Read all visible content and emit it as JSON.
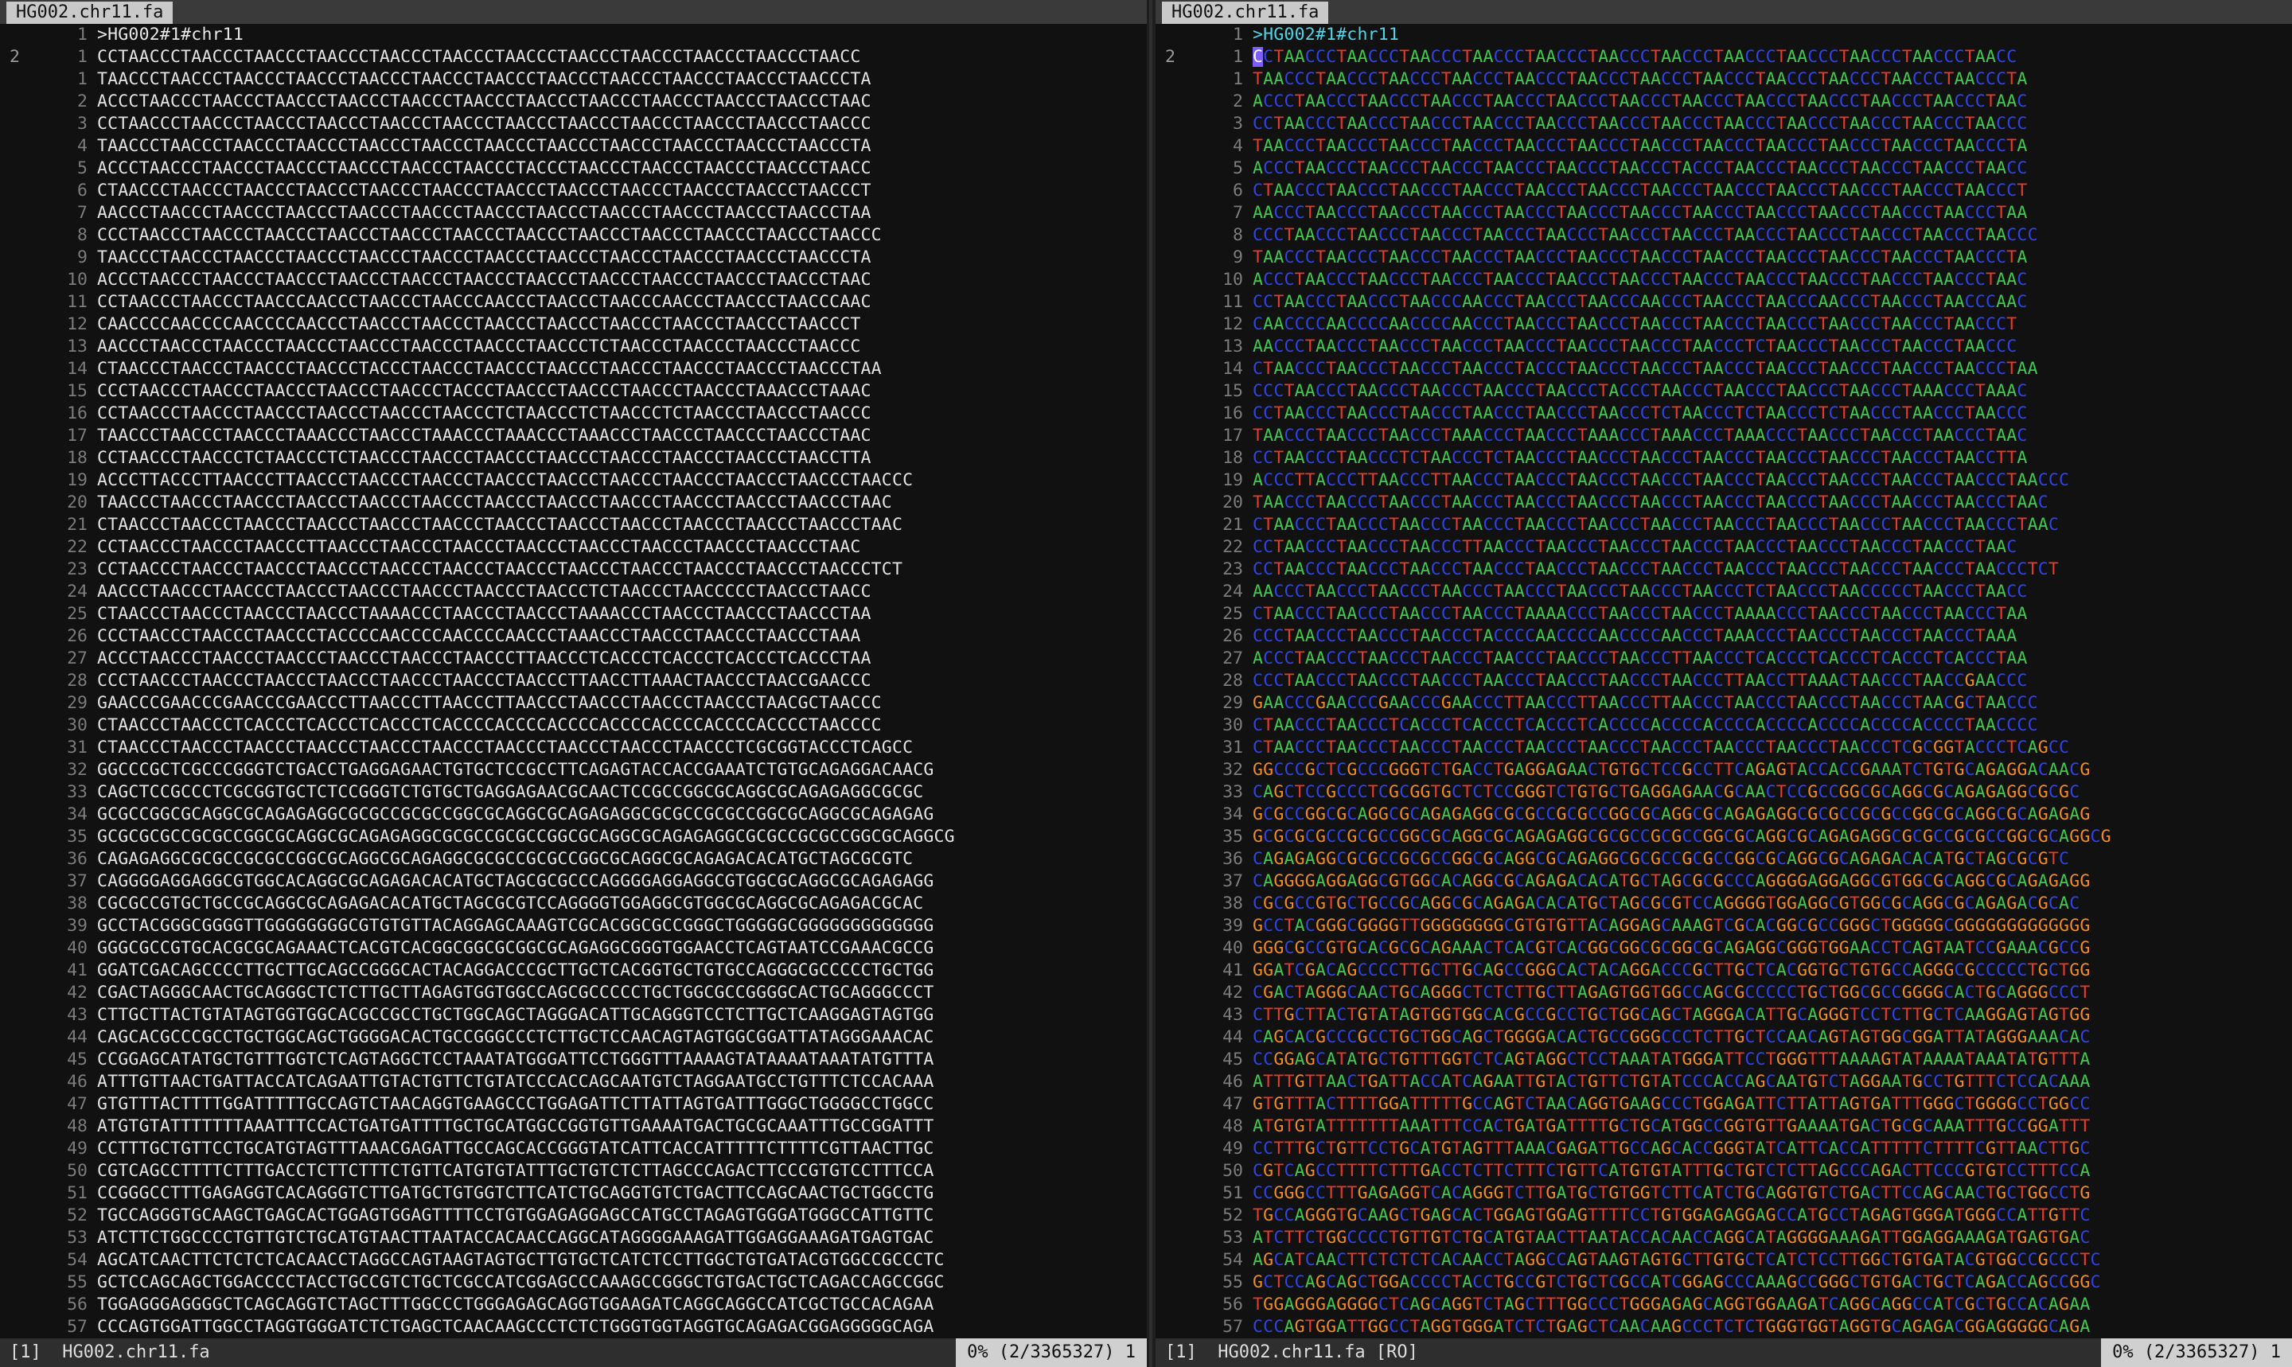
{
  "left": {
    "tab": "HG002.chr11.fa",
    "header": ">HG002#1#chr11",
    "sign": "2",
    "status_buffer": "[1]",
    "status_file": "HG002.chr11.fa",
    "status_pos": "0% (2/3365327) 1",
    "lines": [
      {
        "n": "1",
        "s": "CCTAACCCTAACCCTAACCCTAACCCTAACCCTAACCCTAACCCTAACCCTAACCCTAACCCTAACCCTAACC"
      },
      {
        "n": "1",
        "s": "TAACCCTAACCCTAACCCTAACCCTAACCCTAACCCTAACCCTAACCCTAACCCTAACCCTAACCCTAACCCTA"
      },
      {
        "n": "2",
        "s": "ACCCTAACCCTAACCCTAACCCTAACCCTAACCCTAACCCTAACCCTAACCCTAACCCTAACCCTAACCCTAAC"
      },
      {
        "n": "3",
        "s": "CCTAACCCTAACCCTAACCCTAACCCTAACCCTAACCCTAACCCTAACCCTAACCCTAACCCTAACCCTAACCC"
      },
      {
        "n": "4",
        "s": "TAACCCTAACCCTAACCCTAACCCTAACCCTAACCCTAACCCTAACCCTAACCCTAACCCTAACCCTAACCCTA"
      },
      {
        "n": "5",
        "s": "ACCCTAACCCTAACCCTAACCCTAACCCTAACCCTAACCCTACCCTAACCCTAACCCTAACCCTAACCCTAACC"
      },
      {
        "n": "6",
        "s": "CTAACCCTAACCCTAACCCTAACCCTAACCCTAACCCTAACCCTAACCCTAACCCTAACCCTAACCCTAACCCT"
      },
      {
        "n": "7",
        "s": "AACCCTAACCCTAACCCTAACCCTAACCCTAACCCTAACCCTAACCCTAACCCTAACCCTAACCCTAACCCTAA"
      },
      {
        "n": "8",
        "s": "CCCTAACCCTAACCCTAACCCTAACCCTAACCCTAACCCTAACCCTAACCCTAACCCTAACCCTAACCCTAACCC"
      },
      {
        "n": "9",
        "s": "TAACCCTAACCCTAACCCTAACCCTAACCCTAACCCTAACCCTAACCCTAACCCTAACCCTAACCCTAACCCTA"
      },
      {
        "n": "10",
        "s": "ACCCTAACCCTAACCCTAACCCTAACCCTAACCCTAACCCTAACCCTAACCCTAACCCTAACCCTAACCCTAAC"
      },
      {
        "n": "11",
        "s": "CCTAACCCTAACCCTAACCCAACCCTAACCCTAACCCAACCCTAACCCTAACCCAACCCTAACCCTAACCCAAC"
      },
      {
        "n": "12",
        "s": "CAACCCCAACCCCAACCCCAACCCTAACCCTAACCCTAACCCTAACCCTAACCCTAACCCTAACCCTAACCCT"
      },
      {
        "n": "13",
        "s": "AACCCTAACCCTAACCCTAACCCTAACCCTAACCCTAACCCTAACCCTCTAACCCTAACCCTAACCCTAACCC"
      },
      {
        "n": "14",
        "s": "CTAACCCTAACCCTAACCCTAACCCTACCCTAACCCTAACCCTAACCCTAACCCTAACCCTAACCCTAACCCTAA"
      },
      {
        "n": "15",
        "s": "CCCTAACCCTAACCCTAACCCTAACCCTAACCCTACCCTAACCCTAACCCTAACCCTAACCCTAAACCCTAAAC"
      },
      {
        "n": "16",
        "s": "CCTAACCCTAACCCTAACCCTAACCCTAACCCTAACCCTCTAACCCTCTAACCCTCTAACCCTAACCCTAACCC"
      },
      {
        "n": "17",
        "s": "TAACCCTAACCCTAACCCTAAACCCTAACCCTAAACCCTAAACCCTAAACCCTAACCCTAACCCTAACCCTAAC"
      },
      {
        "n": "18",
        "s": "CCTAACCCTAACCCTCTAACCCTCTAACCCTAACCCTAACCCTAACCCTAACCCTAACCCTAACCCTAACCTTA"
      },
      {
        "n": "19",
        "s": "ACCCTTACCCTTAACCCTTAACCCTAACCCTAACCCTAACCCTAACCCTAACCCTAACCCTAACCCTAACCCTAACCC"
      },
      {
        "n": "20",
        "s": "TAACCCTAACCCTAACCCTAACCCTAACCCTAACCCTAACCCTAACCCTAACCCTAACCCTAACCCTAACCCTAAC"
      },
      {
        "n": "21",
        "s": "CTAACCCTAACCCTAACCCTAACCCTAACCCTAACCCTAACCCTAACCCTAACCCTAACCCTAACCCTAACCCTAAC"
      },
      {
        "n": "22",
        "s": "CCTAACCCTAACCCTAACCCTTAACCCTAACCCTAACCCTAACCCTAACCCTAACCCTAACCCTAACCCTAAC"
      },
      {
        "n": "23",
        "s": "CCTAACCCTAACCCTAACCCTAACCCTAACCCTAACCCTAACCCTAACCCTAACCCTAACCCTAACCCTAACCCTCT"
      },
      {
        "n": "24",
        "s": "AACCCTAACCCTAACCCTAACCCTAACCCTAACCCTAACCCTAACCCTCTAACCCTAACCCCCTAACCCTAACC"
      },
      {
        "n": "25",
        "s": "CTAACCCTAACCCTAACCCTAACCCTAAAACCCTAACCCTAACCCTAAAACCCTAACCCTAACCCTAACCCTAA"
      },
      {
        "n": "26",
        "s": "CCCTAACCCTAACCCTAACCCTACCCCAACCCCAACCCCAACCCTAAACCCTAACCCTAACCCTAACCCTAAA"
      },
      {
        "n": "27",
        "s": "ACCCTAACCCTAACCCTAACCCTAACCCTAACCCTAACCCTTAACCCTCACCCTCACCCTCACCCTCACCCTAA"
      },
      {
        "n": "28",
        "s": "CCCTAACCCTAACCCTAACCCTAACCCTAACCCTAACCCTAACCCTTAACCTTAAACTAACCCTAACCGAACCC"
      },
      {
        "n": "29",
        "s": "GAACCCGAACCCGAACCCGAACCCTTAACCCTTAACCCTTAACCCTAACCCTAACCCTAACCCTAACGCTAACCC"
      },
      {
        "n": "30",
        "s": "CTAACCCTAACCCTCACCCTCACCCTCACCCTCACCCCACCCCACCCCACCCCACCCCACCCCACCCCTAACCCC"
      },
      {
        "n": "31",
        "s": "CTAACCCTAACCCTAACCCTAACCCTAACCCTAACCCTAACCCTAACCCTAACCCTAACCCTCGCGGTACCCTCAGCC"
      },
      {
        "n": "32",
        "s": "GGCCCGCTCGCCCGGGTCTGACCTGAGGAGAACTGTGCTCCGCCTTCAGAGTACCACCGAAATCTGTGCAGAGGACAACG"
      },
      {
        "n": "33",
        "s": "CAGCTCCGCCCTCGCGGTGCTCTCCGGGTCTGTGCTGAGGAGAACGCAACTCCGCCGGCGCAGGCGCAGAGAGGCGCGC"
      },
      {
        "n": "34",
        "s": "GCGCCGGCGCAGGCGCAGAGAGGCGCGCCGCGCCGGCGCAGGCGCAGAGAGGCGCGCCGCGCCGGCGCAGGCGCAGAGAG"
      },
      {
        "n": "35",
        "s": "GCGCGCGCCGCGCCGGCGCAGGCGCAGAGAGGCGCGCCGCGCCGGCGCAGGCGCAGAGAGGCGCGCCGCGCCGGCGCAGGCG"
      },
      {
        "n": "36",
        "s": "CAGAGAGGCGCGCCGCGCCGGCGCAGGCGCAGAGGCGCGCCGCGCCGGCGCAGGCGCAGAGACACATGCTAGCGCGTC"
      },
      {
        "n": "37",
        "s": "CAGGGGAGGAGGCGTGGCACAGGCGCAGAGACACATGCTAGCGCGCCCAGGGGAGGAGGCGTGGCGCAGGCGCAGAGAGG"
      },
      {
        "n": "38",
        "s": "CGCGCCGTGCTGCCGCAGGCGCAGAGACACATGCTAGCGCGTCCAGGGGTGGAGGCGTGGCGCAGGCGCAGAGACGCAC"
      },
      {
        "n": "39",
        "s": "GCCTACGGGCGGGGTTGGGGGGGGCGTGTGTTACAGGAGCAAAGTCGCACGGCGCCGGGCTGGGGGCGGGGGGGGGGGGG"
      },
      {
        "n": "40",
        "s": "GGGCGCCGTGCACGCGCAGAAACTCACGTCACGGCGGCGCGGCGCAGAGGCGGGTGGAACCTCAGTAATCCGAAACGCCG"
      },
      {
        "n": "41",
        "s": "GGATCGACAGCCCCTTGCTTGCAGCCGGGCACTACAGGACCCGCTTGCTCACGGTGCTGTGCCAGGGCGCCCCCTGCTGG"
      },
      {
        "n": "42",
        "s": "CGACTAGGGCAACTGCAGGGCTCTCTTGCTTAGAGTGGTGGCCAGCGCCCCCTGCTGGCGCCGGGGCACTGCAGGGCCCT"
      },
      {
        "n": "43",
        "s": "CTTGCTTACTGTATAGTGGTGGCACGCCGCCTGCTGGCAGCTAGGGACATTGCAGGGTCCTCTTGCTCAAGGAGTAGTGG"
      },
      {
        "n": "44",
        "s": "CAGCACGCCCGCCTGCTGGCAGCTGGGGACACTGCCGGGCCCTCTTGCTCCAACAGTAGTGGCGGATTATAGGGAAACAC"
      },
      {
        "n": "45",
        "s": "CCGGAGCATATGCTGTTTGGTCTCAGTAGGCTCCTAAATATGGGATTCCTGGGTTTAAAAGTATAAAATAAATATGTTTA"
      },
      {
        "n": "46",
        "s": "ATTTGTTAACTGATTACCATCAGAATTGTACTGTTCTGTATCCCACCAGCAATGTCTAGGAATGCCTGTTTCTCCACAAA"
      },
      {
        "n": "47",
        "s": "GTGTTTACTTTTGGATTTTTGCCAGTCTAACAGGTGAAGCCCTGGAGATTCTTATTAGTGATTTGGGCTGGGGCCTGGCC"
      },
      {
        "n": "48",
        "s": "ATGTGTATTTTTTTAAATTTCCACTGATGATTTTGCTGCATGGCCGGTGTTGAAAATGACTGCGCAAATTTGCCGGATTT"
      },
      {
        "n": "49",
        "s": "CCTTTGCTGTTCCTGCATGTAGTTTAAACGAGATTGCCAGCACCGGGTATCATTCACCATTTTTCTTTTCGTTAACTTGC"
      },
      {
        "n": "50",
        "s": "CGTCAGCCTTTTCTTTGACCTCTTCTTTCTGTTCATGTGTATTTGCTGTCTCTTAGCCCAGACTTCCCGTGTCCTTTCCA"
      },
      {
        "n": "51",
        "s": "CCGGGCCTTTGAGAGGTCACAGGGTCTTGATGCTGTGGTCTTCATCTGCAGGTGTCTGACTTCCAGCAACTGCTGGCCTG"
      },
      {
        "n": "52",
        "s": "TGCCAGGGTGCAAGCTGAGCACTGGAGTGGAGTTTTCCTGTGGAGAGGAGCCATGCCTAGAGTGGGATGGGCCATTGTTC"
      },
      {
        "n": "53",
        "s": "ATCTTCTGGCCCCTGTTGTCTGCATGTAACTTAATACCACAACCAGGCATAGGGGAAAGATTGGAGGAAAGATGAGTGAC"
      },
      {
        "n": "54",
        "s": "AGCATCAACTTCTCTCTCACAACCTAGGCCAGTAAGTAGTGCTTGTGCTCATCTCCTTGGCTGTGATACGTGGCCGCCCTC"
      },
      {
        "n": "55",
        "s": "GCTCCAGCAGCTGGACCCCTACCTGCCGTCTGCTCGCCATCGGAGCCCAAAGCCGGGCTGTGACTGCTCAGACCAGCCGGC"
      },
      {
        "n": "56",
        "s": "TGGAGGGAGGGGCTCAGCAGGTCTAGCTTTGGCCCTGGGAGAGCAGGTGGAAGATCAGGCAGGCCATCGCTGCCACAGAA"
      },
      {
        "n": "57",
        "s": "CCCAGTGGATTGGCCTAGGTGGGATCTCTGAGCTCAACAAGCCCTCTCTGGGTGGTAGGTGCAGAGACGGAGGGGGCAGA"
      }
    ]
  },
  "right": {
    "tab": "HG002.chr11.fa",
    "header": ">HG002#1#chr11",
    "sign": "2",
    "status_buffer": "[1]",
    "status_file": "HG002.chr11.fa [RO]",
    "status_pos": "0% (2/3365327) 1",
    "base_colors": {
      "A": "#3ec94d",
      "C": "#2f43e8",
      "G": "#f08a22",
      "T": "#e83a2a"
    }
  }
}
